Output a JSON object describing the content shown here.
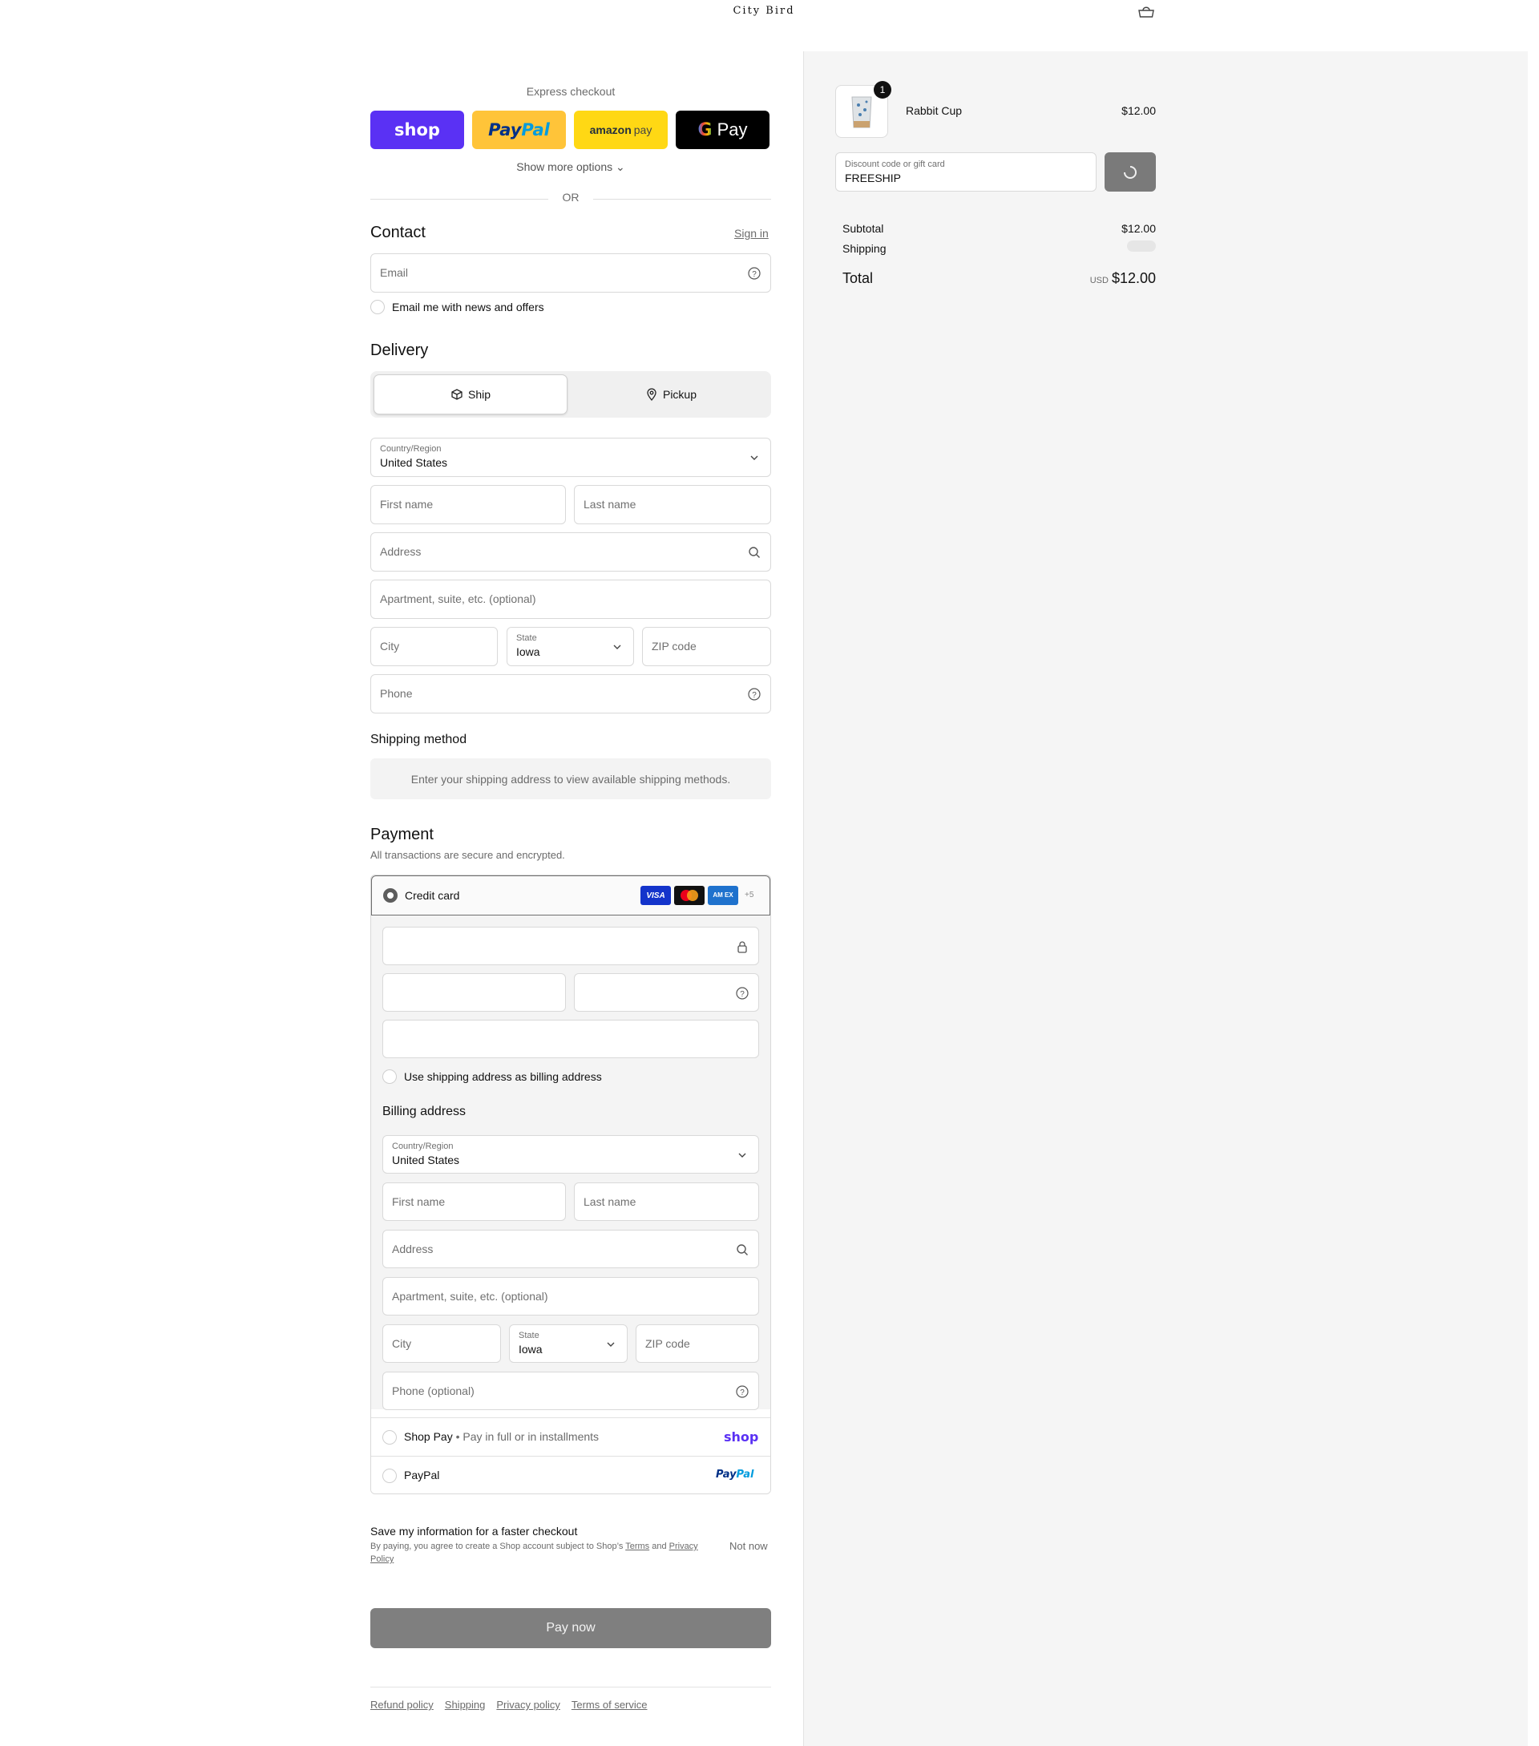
{
  "header": {
    "brand": "City Bird",
    "cart_icon": "bag-icon"
  },
  "express": {
    "title": "Express checkout",
    "shop_label": "shop",
    "paypal_pay": "Pay",
    "paypal_pal": "Pal",
    "amazon_label": "amazon",
    "amazon_pay": "pay",
    "gpay_g": "G",
    "gpay_label": "Pay",
    "show_more": "Show more options",
    "or": "OR"
  },
  "contact": {
    "heading": "Contact",
    "sign_in": "Sign in",
    "email_placeholder": "Email",
    "news_label": "Email me with news and offers"
  },
  "delivery": {
    "heading": "Delivery",
    "ship": "Ship",
    "pickup": "Pickup",
    "country_label": "Country/Region",
    "country_value": "United States",
    "first_name": "First name",
    "last_name": "Last name",
    "address": "Address",
    "apartment": "Apartment, suite, etc. (optional)",
    "city": "City",
    "state_label": "State",
    "state_value": "Iowa",
    "zip": "ZIP code",
    "phone": "Phone"
  },
  "shipping_method": {
    "heading": "Shipping method",
    "note": "Enter your shipping address to view available shipping methods."
  },
  "payment": {
    "heading": "Payment",
    "subtitle": "All transactions are secure and encrypted.",
    "credit_card": "Credit card",
    "cards": {
      "visa": "VISA",
      "amex": "AM EX",
      "more": "+5"
    },
    "use_shipping": "Use shipping address as billing address",
    "billing_heading": "Billing address",
    "billing": {
      "country_label": "Country/Region",
      "country_value": "United States",
      "first_name": "First name",
      "last_name": "Last name",
      "address": "Address",
      "apartment": "Apartment, suite, etc. (optional)",
      "city": "City",
      "state_label": "State",
      "state_value": "Iowa",
      "zip": "ZIP code",
      "phone": "Phone (optional)"
    },
    "shop_pay": "Shop Pay",
    "shop_pay_sub": "Pay in full or in installments",
    "shop_pay_logo": "shop",
    "paypal": "PayPal",
    "paypal_logo_pay": "Pay",
    "paypal_logo_pal": "Pal"
  },
  "save": {
    "title": "Save my information for a faster checkout",
    "sub_prefix": "By paying, you agree to create a Shop account subject to Shop’s ",
    "terms": "Terms",
    "and": " and ",
    "privacy": "Privacy Policy",
    "not_now": "Not now"
  },
  "pay_now": "Pay now",
  "footer": [
    "Refund policy",
    "Shipping",
    "Privacy policy",
    "Terms of service"
  ],
  "summary": {
    "item_name": "Rabbit Cup",
    "item_qty": "1",
    "item_price": "$12.00",
    "discount_label": "Discount code or gift card",
    "discount_value": "FREESHIP",
    "subtotal_label": "Subtotal",
    "subtotal_value": "$12.00",
    "shipping_label": "Shipping",
    "total_label": "Total",
    "currency": "USD",
    "total_value": "$12.00"
  }
}
